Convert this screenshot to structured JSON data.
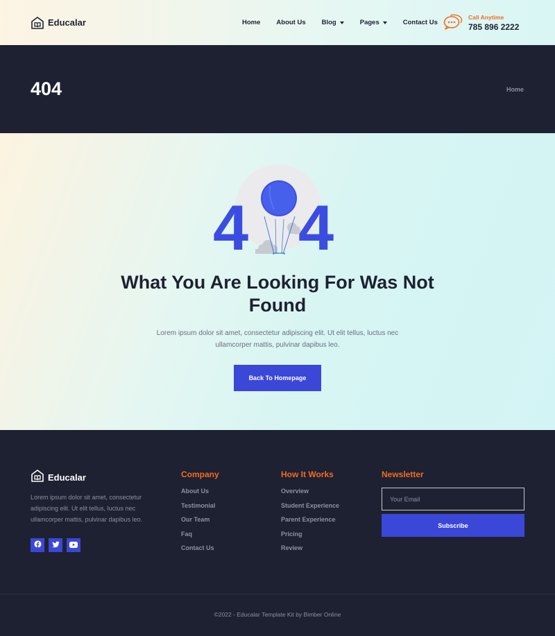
{
  "header": {
    "logo_text": "Educalar",
    "nav": [
      {
        "label": "Home",
        "has_dropdown": false
      },
      {
        "label": "About Us",
        "has_dropdown": false
      },
      {
        "label": "Blog",
        "has_dropdown": true
      },
      {
        "label": "Pages",
        "has_dropdown": true
      },
      {
        "label": "Contact Us",
        "has_dropdown": false
      }
    ],
    "call_label": "Call Anytime",
    "call_number": "785 896 2222"
  },
  "title_band": {
    "title": "404",
    "breadcrumb": "Home"
  },
  "main": {
    "illustration_text": "404",
    "heading": "What You Are Looking For Was Not Found",
    "description": "Lorem ipsum dolor sit amet, consectetur adipiscing elit. Ut elit tellus, luctus nec ullamcorper mattis, pulvinar dapibus leo.",
    "button_label": "Back To Homepage"
  },
  "footer": {
    "logo_text": "Educalar",
    "about": "Lorem ipsum dolor sit amet, consectetur adipiscing elit. Ut elit tellus, luctus nec ullamcorper mattis, pulvinar dapibus leo.",
    "socials": [
      "facebook-icon",
      "twitter-icon",
      "youtube-icon"
    ],
    "company": {
      "title": "Company",
      "links": [
        "About Us",
        "Testimonial",
        "Our Team",
        "Faq",
        "Contact Us"
      ]
    },
    "how_it_works": {
      "title": "How It Works",
      "links": [
        "Overview",
        "Student Experience",
        "Parent Experience",
        "Pricing",
        "Review"
      ]
    },
    "newsletter": {
      "title": "Newsletter",
      "email_placeholder": "Your Email",
      "button_label": "Subscribe"
    },
    "copyright": "©2022 - Educalar Template Kit by Bimber Online"
  },
  "colors": {
    "accent": "#3b47d6",
    "orange": "#f26b21",
    "dark": "#1e2131",
    "muted": "#8d90a0"
  }
}
